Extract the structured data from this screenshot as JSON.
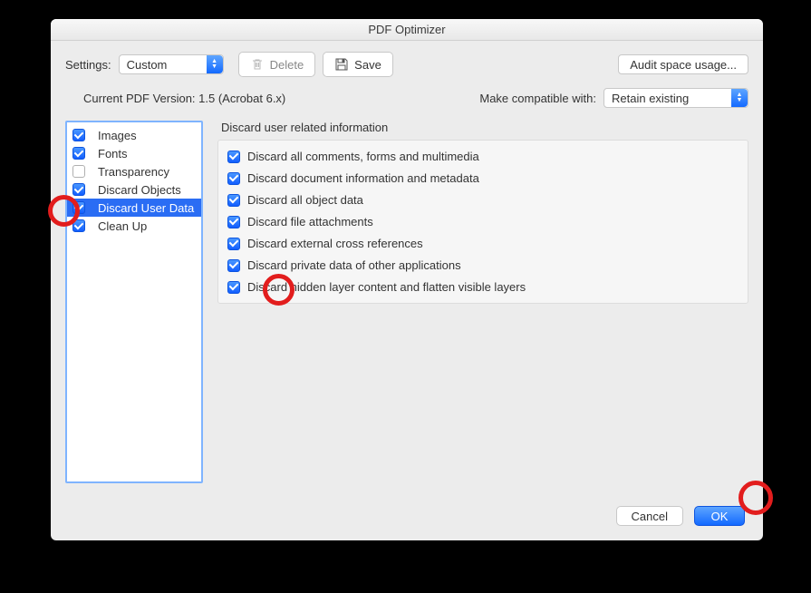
{
  "title": "PDF Optimizer",
  "toolbar": {
    "settings_label": "Settings:",
    "settings_value": "Custom",
    "delete_label": "Delete",
    "save_label": "Save",
    "audit_label": "Audit space usage..."
  },
  "version_row": {
    "current_label": "Current PDF Version: 1.5 (Acrobat 6.x)",
    "compat_label": "Make compatible with:",
    "compat_value": "Retain existing"
  },
  "sidebar": {
    "items": [
      {
        "label": "Images",
        "checked": true,
        "selected": false
      },
      {
        "label": "Fonts",
        "checked": true,
        "selected": false
      },
      {
        "label": "Transparency",
        "checked": false,
        "selected": false
      },
      {
        "label": "Discard Objects",
        "checked": true,
        "selected": false
      },
      {
        "label": "Discard User Data",
        "checked": true,
        "selected": true
      },
      {
        "label": "Clean Up",
        "checked": true,
        "selected": false
      }
    ]
  },
  "panel": {
    "title": "Discard user related information",
    "options": [
      {
        "label": "Discard all comments, forms and multimedia",
        "checked": true
      },
      {
        "label": "Discard document information and metadata",
        "checked": true
      },
      {
        "label": "Discard all object data",
        "checked": true
      },
      {
        "label": "Discard file attachments",
        "checked": true
      },
      {
        "label": "Discard external cross references",
        "checked": true
      },
      {
        "label": "Discard private data of other applications",
        "checked": true
      },
      {
        "label": "Discard hidden layer content and flatten visible layers",
        "checked": true
      }
    ]
  },
  "footer": {
    "cancel_label": "Cancel",
    "ok_label": "OK"
  }
}
